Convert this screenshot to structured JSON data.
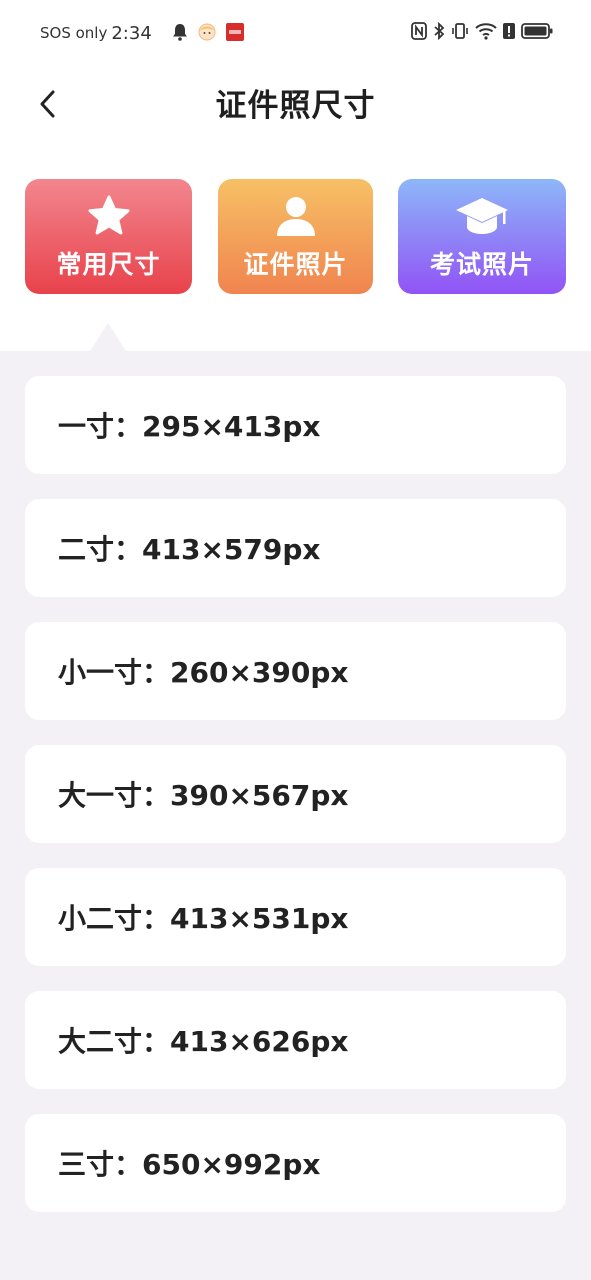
{
  "status_bar": {
    "sos": "SOS only",
    "time": "2:34",
    "battery_label": ""
  },
  "header": {
    "title": "证件照尺寸",
    "back_icon": "chevron-left-icon"
  },
  "categories": [
    {
      "label": "常用尺寸",
      "icon": "star-icon",
      "color_top": "#f2868e",
      "color_bottom": "#e8424b"
    },
    {
      "label": "证件照片",
      "icon": "person-icon",
      "color_top": "#f7c065",
      "color_bottom": "#f0844f"
    },
    {
      "label": "考试照片",
      "icon": "graduation-cap-icon",
      "color_top": "#8db7f8",
      "color_bottom": "#9153f5"
    }
  ],
  "sizes": [
    {
      "label": "一寸：295×413px"
    },
    {
      "label": "二寸：413×579px"
    },
    {
      "label": "小一寸：260×390px"
    },
    {
      "label": "大一寸：390×567px"
    },
    {
      "label": "小二寸：413×531px"
    },
    {
      "label": "大二寸：413×626px"
    },
    {
      "label": "三寸：650×992px"
    }
  ],
  "colors": {
    "background": "#f3f1f6",
    "card": "#ffffff",
    "text": "#222222"
  }
}
